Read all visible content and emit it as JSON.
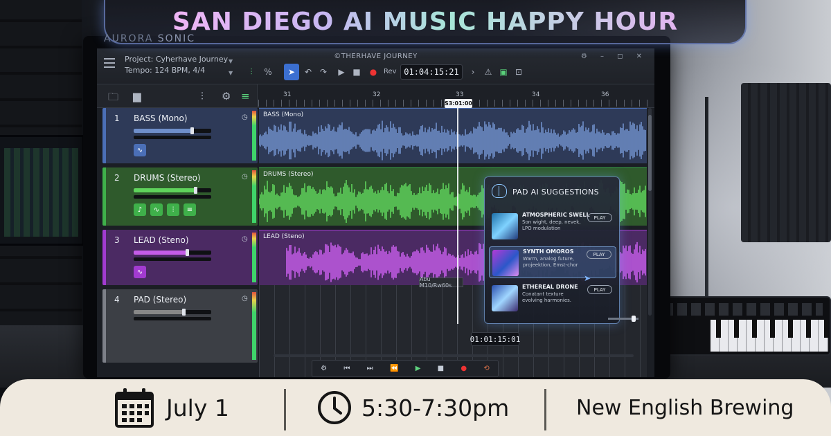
{
  "event": {
    "headline": "SAN DIEGO AI MUSIC HAPPY HOUR",
    "date": "July 1",
    "time": "5:30-7:30pm",
    "venue": "New English Brewing",
    "icons": {
      "date": "calendar-icon",
      "time": "clock-icon"
    }
  },
  "brand": {
    "name_part1": "AURORA",
    "name_part2": "SONIC"
  },
  "daw": {
    "app_title": "©THERHAVE JOURNEY",
    "project_line": "Project: Cyherhave Journey",
    "tempo_line": "Tempo: 124 BPM,  4/4",
    "rev_label": "Rev",
    "main_time": "01:04:15:21",
    "transport_time": "01:01:15:01",
    "playhead_label": "S3:01:00",
    "ruler_ticks": [
      "31",
      "32",
      "33",
      "34",
      "36"
    ],
    "clip_tag": "Abu M10/Rw60s",
    "tracks": [
      {
        "num": "1",
        "name": "BASS (Mono)",
        "lane_label": "BASS (Mono)",
        "color": "#4b6fb7",
        "bg": "#2e3a58",
        "wave": "#6f8fca",
        "fader": 0.76
      },
      {
        "num": "2",
        "name": "DRUMS (Stereo)",
        "lane_label": "DRUMS (Stereo)",
        "color": "#3fb04a",
        "bg": "#2f5a2c",
        "wave": "#5fd35c",
        "fader": 0.8
      },
      {
        "num": "3",
        "name": "LEAD (Steno)",
        "lane_label": "LEAD (Steno)",
        "color": "#a23bd0",
        "bg": "#4b2a63",
        "wave": "#c45ce8",
        "fader": 0.7
      },
      {
        "num": "4",
        "name": "PAD (Stereo)",
        "lane_label": "",
        "color": "#7d8088",
        "bg": "#3c3f45",
        "wave": "#888",
        "fader": 0.65
      }
    ],
    "colors": {
      "accent": "#3b6fd1",
      "record": "#ee3333"
    }
  },
  "ai_panel": {
    "title": "PAD AI SUGGESTIONS",
    "items": [
      {
        "title": "ATMOSPHERIC SWELL",
        "desc": "Son wight, deep, nevek, LPO modulation",
        "button": "PLAY",
        "selected": false
      },
      {
        "title": "SYNTH OMOROS",
        "desc": "Warm, analog future, projeektion, Emst-chor",
        "button": "PLAY",
        "selected": true
      },
      {
        "title": "ETHEREAL DRONE",
        "desc": "Conatant texture evolving harmonies.",
        "button": "PLAY",
        "selected": false
      }
    ]
  }
}
